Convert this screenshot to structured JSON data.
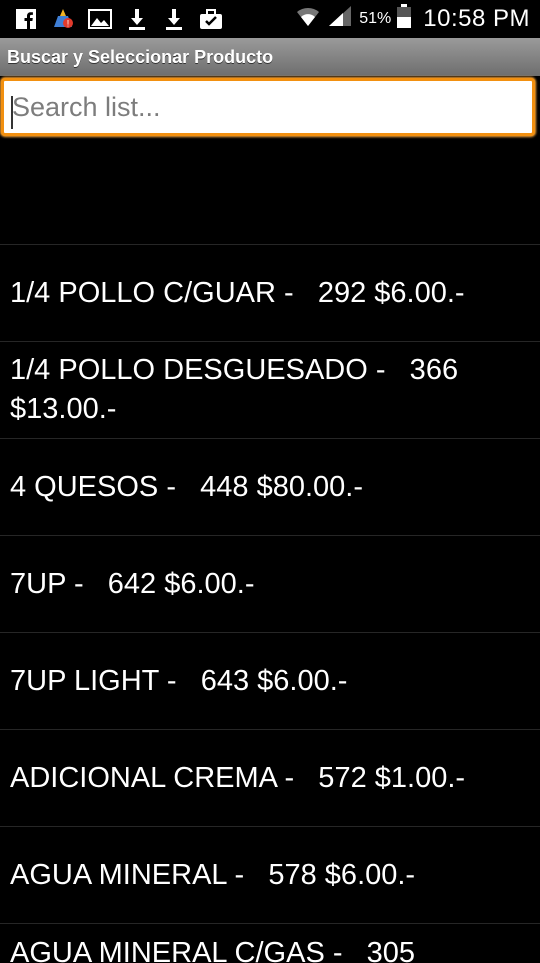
{
  "status_bar": {
    "icons_left": [
      "facebook-icon",
      "cleaner-icon",
      "gallery-icon",
      "download-icon",
      "download-icon",
      "briefcase-icon"
    ],
    "icons_right": [
      "wifi-icon",
      "signal-icon",
      "battery-icon"
    ],
    "battery_percent": "51%",
    "time": "10:58 PM"
  },
  "title_bar": {
    "title": "Buscar y Seleccionar Producto"
  },
  "search": {
    "placeholder": "Search list...",
    "value": ""
  },
  "colors": {
    "accent": "#f29010",
    "titlebar": "#8a8a8a",
    "background": "#000000"
  },
  "list": {
    "items": [
      "1/4 POLLO C/GUAR -   292 $6.00.-",
      "1/4 POLLO DESGUESADO -   366 $13.00.-",
      "4 QUESOS -   448 $80.00.-",
      "7UP -   642 $6.00.-",
      "7UP LIGHT -   643 $6.00.-",
      "ADICIONAL CREMA -   572 $1.00.-",
      "AGUA MINERAL -   578 $6.00.-",
      "AGUA MINERAL C/GAS -   305"
    ]
  }
}
